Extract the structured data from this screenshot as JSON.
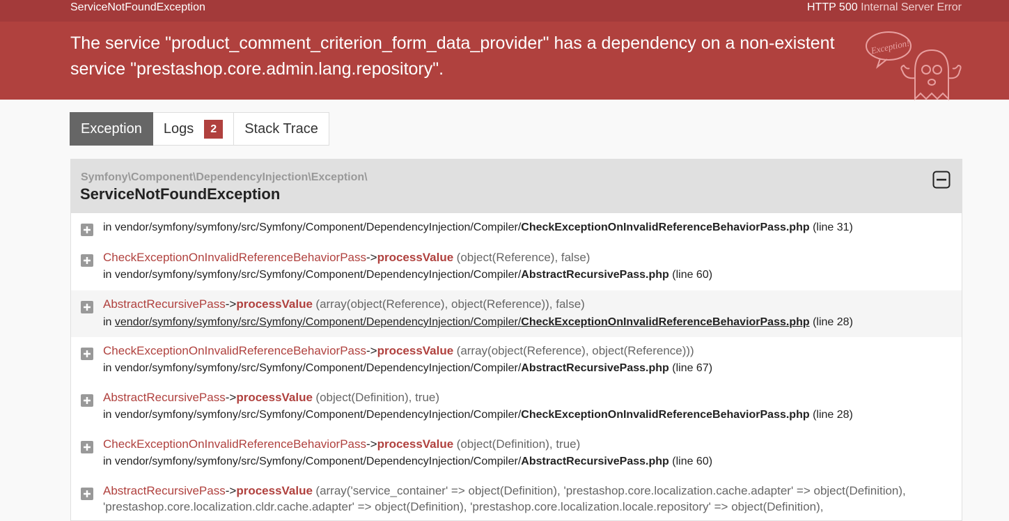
{
  "topbar": {
    "exception_class": "ServiceNotFoundException",
    "status_code": "HTTP 500",
    "status_text": "Internal Server Error"
  },
  "header": {
    "message": "The service \"product_comment_criterion_form_data_provider\" has a dependency on a non-existent service \"prestashop.core.admin.lang.repository\".",
    "ghost_bubble": "Exception!"
  },
  "tabs": [
    {
      "label": "Exception",
      "active": true
    },
    {
      "label": "Logs",
      "badge": "2"
    },
    {
      "label": "Stack Trace"
    }
  ],
  "exception": {
    "namespace": "Symfony\\Component\\DependencyInjection\\Exception\\",
    "class": "ServiceNotFoundException"
  },
  "trace": [
    {
      "in_prefix": "in vendor/symfony/symfony/src/Symfony/Component/DependencyInjection/Compiler/",
      "file": "CheckExceptionOnInvalidReferenceBehaviorPass.php",
      "line": "(line 31)"
    },
    {
      "class": "CheckExceptionOnInvalidReferenceBehaviorPass",
      "method": "processValue",
      "args": "(object(Reference), false)",
      "in_prefix": "in vendor/symfony/symfony/src/Symfony/Component/DependencyInjection/Compiler/",
      "file": "AbstractRecursivePass.php",
      "line": "(line 60)"
    },
    {
      "class": "AbstractRecursivePass",
      "method": "processValue",
      "args": "(array(object(Reference), object(Reference)), false)",
      "in_prefix": "in ",
      "path": "vendor/symfony/symfony/src/Symfony/Component/DependencyInjection/Compiler/",
      "file": "CheckExceptionOnInvalidReferenceBehaviorPass.php",
      "line": "(line 28)"
    },
    {
      "class": "CheckExceptionOnInvalidReferenceBehaviorPass",
      "method": "processValue",
      "args": "(array(object(Reference), object(Reference)))",
      "in_prefix": "in vendor/symfony/symfony/src/Symfony/Component/DependencyInjection/Compiler/",
      "file": "AbstractRecursivePass.php",
      "line": "(line 67)"
    },
    {
      "class": "AbstractRecursivePass",
      "method": "processValue",
      "args": "(object(Definition), true)",
      "in_prefix": "in vendor/symfony/symfony/src/Symfony/Component/DependencyInjection/Compiler/",
      "file": "CheckExceptionOnInvalidReferenceBehaviorPass.php",
      "line": "(line 28)"
    },
    {
      "class": "CheckExceptionOnInvalidReferenceBehaviorPass",
      "method": "processValue",
      "args": "(object(Definition), true)",
      "in_prefix": "in vendor/symfony/symfony/src/Symfony/Component/DependencyInjection/Compiler/",
      "file": "AbstractRecursivePass.php",
      "line": "(line 60)"
    },
    {
      "class": "AbstractRecursivePass",
      "method": "processValue",
      "args": "(array('service_container' => object(Definition), 'prestashop.core.localization.cache.adapter' => object(Definition),",
      "args2": "'prestashop.core.localization.cldr.cache.adapter' => object(Definition), 'prestashop.core.localization.locale.repository' => object(Definition),"
    }
  ]
}
